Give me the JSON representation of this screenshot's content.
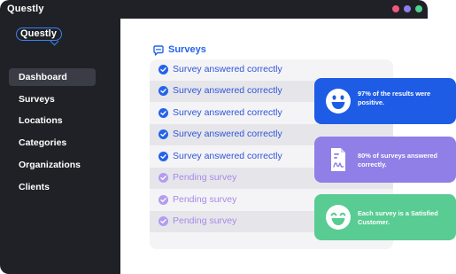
{
  "app": {
    "title": "Questly",
    "logo_text": "Questly"
  },
  "colors": {
    "sidebar_bg": "#1f2127",
    "accent_blue": "#2563eb",
    "pending_purple": "#a68ae8",
    "card_blue": "#1e5ce6",
    "card_purple": "#8f7fe6",
    "card_green": "#58cc92"
  },
  "sidebar": {
    "items": [
      {
        "label": "Dashboard",
        "active": true
      },
      {
        "label": "Surveys",
        "active": false
      },
      {
        "label": "Locations",
        "active": false
      },
      {
        "label": "Categories",
        "active": false
      },
      {
        "label": "Organizations",
        "active": false
      },
      {
        "label": "Clients",
        "active": false
      }
    ]
  },
  "surveys": {
    "title": "Surveys",
    "icon": "chat-bubble-icon",
    "rows": [
      {
        "text": "Survey answered correctly",
        "status": "answered",
        "icon": "check-circle-icon"
      },
      {
        "text": "Survey answered correctly",
        "status": "answered",
        "icon": "check-circle-icon"
      },
      {
        "text": "Survey answered correctly",
        "status": "answered",
        "icon": "check-circle-icon"
      },
      {
        "text": "Survey answered correctly",
        "status": "answered",
        "icon": "check-circle-icon"
      },
      {
        "text": "Survey answered correctly",
        "status": "answered",
        "icon": "check-circle-icon"
      },
      {
        "text": "Pending survey",
        "status": "pending",
        "icon": "check-circle-icon"
      },
      {
        "text": "Pending survey",
        "status": "pending",
        "icon": "check-circle-icon"
      },
      {
        "text": "Pending survey",
        "status": "pending",
        "icon": "check-circle-icon"
      }
    ]
  },
  "cards": [
    {
      "text": "97% of the results were positive.",
      "icon": "smiley-face-icon"
    },
    {
      "text": "80% of surveys answered correctly.",
      "icon": "document-signature-icon"
    },
    {
      "text": "Each survey is a Satisfied Customer.",
      "icon": "happy-face-icon"
    }
  ]
}
